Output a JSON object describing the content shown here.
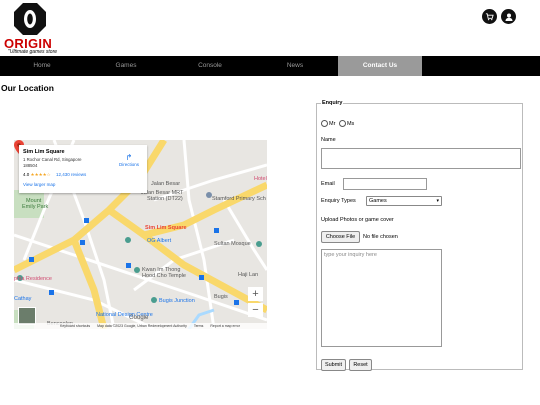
{
  "header": {
    "brand": "ORIGIN",
    "tagline": "\"Ultimate games store",
    "cart_icon": "cart-icon",
    "user_icon": "user-icon"
  },
  "nav": {
    "items": [
      {
        "label": "Home",
        "active": false
      },
      {
        "label": "Games",
        "active": false
      },
      {
        "label": "Console",
        "active": false
      },
      {
        "label": "News",
        "active": false
      },
      {
        "label": "Contact Us",
        "active": true
      }
    ]
  },
  "page": {
    "title": "Our Location"
  },
  "map": {
    "place_name": "Sim Lim Square",
    "address_line1": "1 Rochor Canal Rd, Singapore",
    "address_line2": "188504",
    "rating": "4.0",
    "stars": "★★★★☆",
    "reviews": "12,430 reviews",
    "view_larger": "View larger map",
    "directions": "Directions",
    "pin_label": "Sim Lim Square",
    "labels": {
      "station": "Jalan Besar",
      "station2": "Jalan Besar MRT",
      "station3": "Station (DT22)",
      "school": "Stamford Primary Sch",
      "mount": "Mount",
      "mount2": "Emily Park",
      "ogalbert": "OG Albert",
      "sultan": "Sultan Mosque",
      "kwan": "Kwan Im Thong",
      "kwan2": "Hood Cho Temple",
      "residence": "phia Residence",
      "bugis_junction": "Bugis Junction",
      "bugis": "Bugis",
      "cathay": "Cathay",
      "ndc": "National Design Centre",
      "bencoolen": "Bencoolen",
      "hotel": "Hotel",
      "hajlane": "Haji Lan"
    },
    "zoom_in": "+",
    "zoom_out": "−",
    "google": "Google",
    "footer": [
      "Keyboard shortcuts",
      "Map data ©2023 Google, Urban Redevelopment Authority",
      "Terms",
      "Report a map error"
    ]
  },
  "form": {
    "legend": "Enquiry",
    "title_options": [
      "Mr",
      "Ms"
    ],
    "name_label": "Name",
    "email_label": "Email",
    "enquiry_types_label": "Enquiry Types",
    "enquiry_type_selected": "Games",
    "upload_label": "Upload Photos or game cover",
    "choose_file": "Choose File",
    "no_file": "No file chosen",
    "inquiry_placeholder": "type your inquiry here",
    "submit": "Submit",
    "reset": "Reset"
  },
  "colors": {
    "nav_bg": "#000000",
    "nav_active": "#9a9a9a",
    "brand_red": "#cc0000",
    "map_road": "#f9d86b",
    "link_blue": "#1a73e8"
  }
}
